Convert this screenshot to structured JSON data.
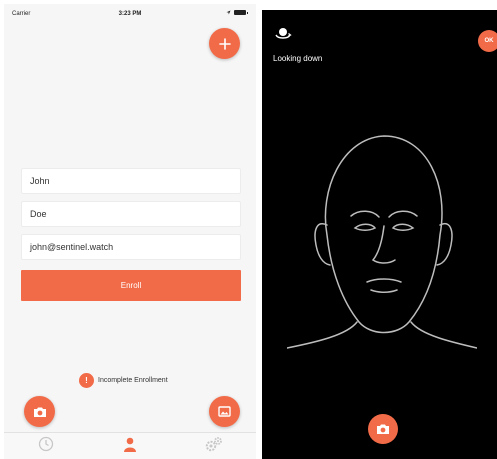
{
  "colors": {
    "accent": "#f26b48",
    "right_background": "#000000",
    "left_background": "#f6f6f6",
    "face_stroke": "#bdbdbd"
  },
  "status_bar": {
    "carrier": "Carrier",
    "time": "3:23 PM"
  },
  "form": {
    "first_name": "John",
    "last_name": "Doe",
    "email": "john@sentinel.watch",
    "enroll_label": "Enroll"
  },
  "status": {
    "alert_glyph": "!",
    "incomplete_label": "Incomplete Enrollment"
  },
  "icons": {
    "add": "plus-icon",
    "camera": "camera-icon",
    "gallery": "image-icon",
    "tab_1": "clock-icon",
    "tab_2": "person-icon",
    "tab_3": "gears-icon",
    "look": "head-rotate-icon",
    "capture": "camera-icon"
  },
  "camera_view": {
    "instruction": "Looking down",
    "ok_label": "OK"
  }
}
